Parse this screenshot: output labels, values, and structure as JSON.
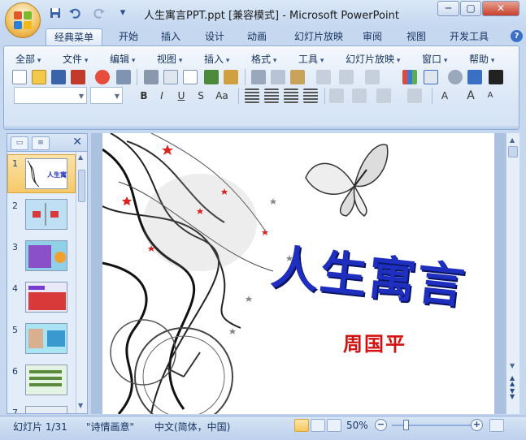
{
  "window": {
    "title": "人生寓言PPT.ppt [兼容模式] - Microsoft PowerPoint",
    "controls": {
      "minimize": "─",
      "maximize": "▢",
      "close": "✕"
    }
  },
  "quick_access": {
    "save": "save-icon",
    "undo": "undo-icon",
    "redo": "redo-icon",
    "customize": "▾"
  },
  "tabs": [
    {
      "label": "经典菜单",
      "active": true
    },
    {
      "label": "开始"
    },
    {
      "label": "插入"
    },
    {
      "label": "设计"
    },
    {
      "label": "动画"
    },
    {
      "label": "幻灯片放映"
    },
    {
      "label": "审阅"
    },
    {
      "label": "视图"
    },
    {
      "label": "开发工具"
    }
  ],
  "menus": [
    "全部",
    "文件",
    "编辑",
    "视图",
    "插入",
    "格式",
    "工具",
    "幻灯片放映",
    "窗口",
    "帮助"
  ],
  "format_buttons": {
    "bold": "B",
    "italic": "I",
    "underline": "U",
    "strike": "S",
    "case": "Aa"
  },
  "font_controls": {
    "grow": "A",
    "shrink": "A"
  },
  "panel": {
    "close": "✕"
  },
  "thumbnails": [
    {
      "num": "1",
      "selected": true
    },
    {
      "num": "2"
    },
    {
      "num": "3"
    },
    {
      "num": "4"
    },
    {
      "num": "5"
    },
    {
      "num": "6"
    },
    {
      "num": "7"
    }
  ],
  "slide": {
    "title": "人生寓言",
    "author": "周国平"
  },
  "status": {
    "slide_info": "幻灯片 1/31",
    "theme": "\"诗情画意\"",
    "language": "中文(简体，中国)",
    "zoom": "50%",
    "zoom_out": "−",
    "zoom_in": "+"
  }
}
